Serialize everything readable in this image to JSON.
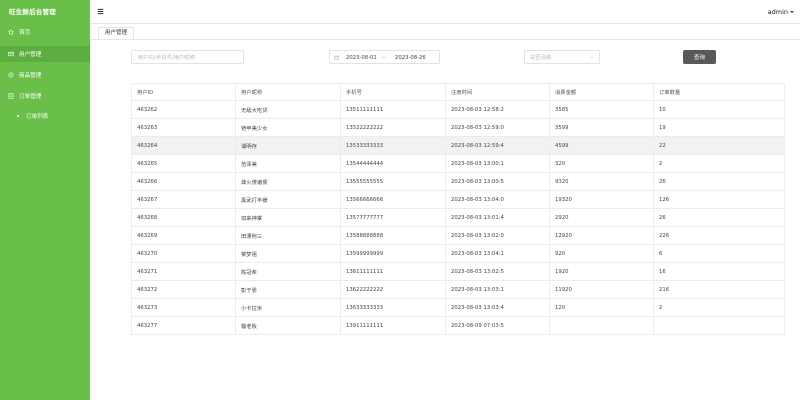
{
  "app": {
    "title": "旺生鲜后台管理"
  },
  "sidebar": {
    "items": [
      {
        "label": "首页",
        "icon": "home-icon"
      },
      {
        "label": "用户管理",
        "icon": "mail-icon"
      },
      {
        "label": "商品管理",
        "icon": "box-icon"
      },
      {
        "label": "订单管理",
        "icon": "list-icon"
      },
      {
        "label": "订单列表",
        "icon": "bullet-icon"
      }
    ]
  },
  "header": {
    "user": "admin"
  },
  "tabs": [
    {
      "label": "用户管理"
    }
  ],
  "filters": {
    "search_placeholder": "用户ID/手机号/用户昵称",
    "date_start": "2023-08-01",
    "date_separator": "-",
    "date_end": "2023-08-26",
    "status_placeholder": "是否消费",
    "query_label": "查询"
  },
  "table": {
    "columns": [
      "用户ID",
      "用户昵称",
      "手机号",
      "注册时间",
      "消费金额",
      "订单数量"
    ],
    "rows": [
      [
        "463262",
        "无敌大吃货",
        "13511111111",
        "2023-08-03 12:58:2",
        "3585",
        "10"
      ],
      [
        "463263",
        "铠甲美少女",
        "13522222222",
        "2023-08-03 12:59:0",
        "3599",
        "19"
      ],
      [
        "463264",
        "谭明存",
        "13533333333",
        "2023-08-03 12:59:4",
        "4599",
        "22"
      ],
      [
        "463265",
        "范泽美",
        "13544444444",
        "2023-08-03 13:00:1",
        "320",
        "2"
      ],
      [
        "463266",
        "烽火燎诸侯",
        "13555555555",
        "2023-08-03 13:00:5",
        "9320",
        "26"
      ],
      [
        "463267",
        "黑武打丰缓",
        "13566666666",
        "2023-08-03 13:04:0",
        "19320",
        "126"
      ],
      [
        "463268",
        "如来神掌",
        "13577777777",
        "2023-08-03 13:01:4",
        "2920",
        "26"
      ],
      [
        "463269",
        "田漂阿三",
        "13588888888",
        "2023-08-03 13:02:0",
        "12920",
        "226"
      ],
      [
        "463270",
        "菜梦祖",
        "13599999999",
        "2023-08-03 13:04:1",
        "920",
        "6"
      ],
      [
        "463271",
        "陈冠希",
        "13611111111",
        "2023-08-03 13:02:5",
        "1920",
        "16"
      ],
      [
        "463272",
        "彭于晏",
        "13622222222",
        "2023-08-03 13:03:1",
        "11920",
        "216"
      ],
      [
        "463273",
        "小卡拉米",
        "13633333333",
        "2023-08-03 13:03:4",
        "120",
        "2"
      ],
      [
        "463277",
        "醫老板",
        "13911111111",
        "2023-08-09 07:03:5",
        "",
        ""
      ]
    ]
  },
  "colors": {
    "sidebar": "#6abf4b",
    "sidebar_active": "#5aad3e",
    "button": "#595959"
  }
}
